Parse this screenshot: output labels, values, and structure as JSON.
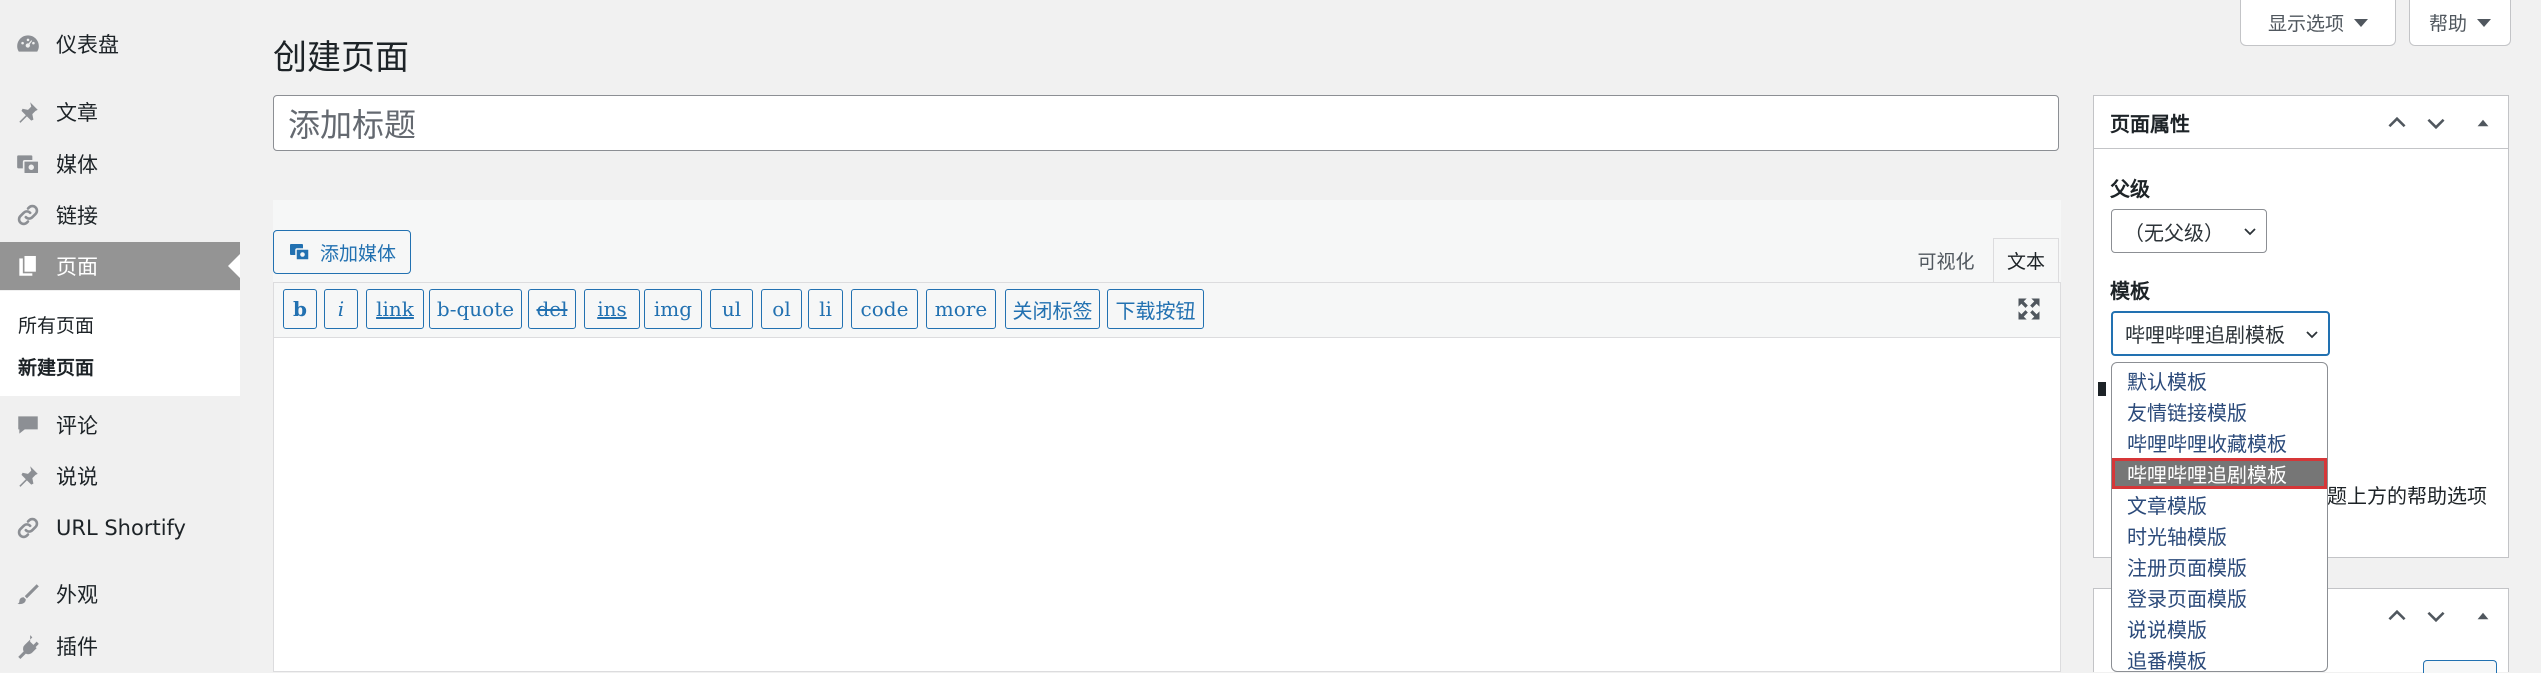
{
  "sidebar": {
    "dashboard": "仪表盘",
    "posts": "文章",
    "media": "媒体",
    "links": "链接",
    "pages": "页面",
    "pages_sub_all": "所有页面",
    "pages_sub_new": "新建页面",
    "comments": "评论",
    "shuoshuo": "说说",
    "url_shortify": "URL Shortify",
    "appearance": "外观",
    "plugins": "插件"
  },
  "screen_options": {
    "label": "显示选项"
  },
  "help": {
    "label": "帮助"
  },
  "page_title": "创建页面",
  "title_input": {
    "placeholder": "添加标题"
  },
  "editor": {
    "add_media": "添加媒体",
    "tab_visual": "可视化",
    "tab_text": "文本",
    "quicktags": [
      "b",
      "i",
      "link",
      "b-quote",
      "del",
      "ins",
      "img",
      "ul",
      "ol",
      "li",
      "code",
      "more",
      "关闭标签",
      "下载按钮"
    ]
  },
  "page_attributes": {
    "title": "页面属性",
    "parent_label": "父级",
    "parent_value": "（无父级）",
    "template_label": "模板",
    "template_value": "哔哩哔哩追剧模板",
    "template_options": [
      "默认模板",
      "友情链接模版",
      "哔哩哔哩收藏模板",
      "哔哩哔哩追剧模板",
      "文章模版",
      "时光轴模版",
      "注册页面模版",
      "登录页面模版",
      "说说模版",
      "追番模板"
    ],
    "selected_option_index": 3,
    "help_text_fragment": "题上方的帮助选项"
  },
  "icons": [
    "dashboard-icon",
    "pushpin-icon",
    "media-icon",
    "link-icon",
    "page-icon",
    "comment-icon",
    "pushpin-icon",
    "link-icon",
    "brush-icon",
    "plug-icon",
    "fullscreen-icon",
    "chevron-up-icon",
    "chevron-down-icon",
    "triangle-up-icon"
  ],
  "colors": {
    "accent": "#2271b1",
    "sidebar_active": "#949494",
    "selected_option": "#767676",
    "highlight_border": "#d63638"
  }
}
